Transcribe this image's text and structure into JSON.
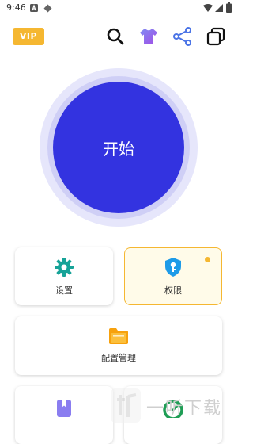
{
  "status_bar": {
    "time": "9:46"
  },
  "header": {
    "vip_label": "VIP"
  },
  "start": {
    "label": "开始"
  },
  "cards": {
    "settings": {
      "label": "设置"
    },
    "permissions": {
      "label": "权限"
    },
    "config": {
      "label": "配置管理"
    }
  },
  "watermark": {
    "text": "一听下载"
  },
  "colors": {
    "primary": "#3333e0",
    "accent": "#f5b731",
    "teal": "#17a398",
    "light_blue": "#1e9be8"
  }
}
